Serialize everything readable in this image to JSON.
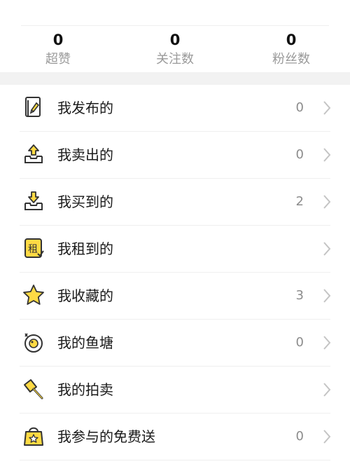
{
  "stats": [
    {
      "value": "0",
      "label": "超赞"
    },
    {
      "value": "0",
      "label": "关注数"
    },
    {
      "value": "0",
      "label": "粉丝数"
    }
  ],
  "menu": [
    {
      "label": "我发布的",
      "count": "0",
      "icon": "publish-icon"
    },
    {
      "label": "我卖出的",
      "count": "0",
      "icon": "sold-icon"
    },
    {
      "label": "我买到的",
      "count": "2",
      "icon": "bought-icon"
    },
    {
      "label": "我租到的",
      "count": "",
      "icon": "rent-icon"
    },
    {
      "label": "我收藏的",
      "count": "3",
      "icon": "star-icon"
    },
    {
      "label": "我的鱼塘",
      "count": "0",
      "icon": "pond-icon"
    },
    {
      "label": "我的拍卖",
      "count": "",
      "icon": "auction-hammer-icon"
    },
    {
      "label": "我参与的免费送",
      "count": "0",
      "icon": "gift-bag-icon"
    }
  ],
  "colors": {
    "accent": "#ffda44",
    "outline": "#333333",
    "muted": "#9a9a9a",
    "section_gap": "#f2f2f2"
  }
}
